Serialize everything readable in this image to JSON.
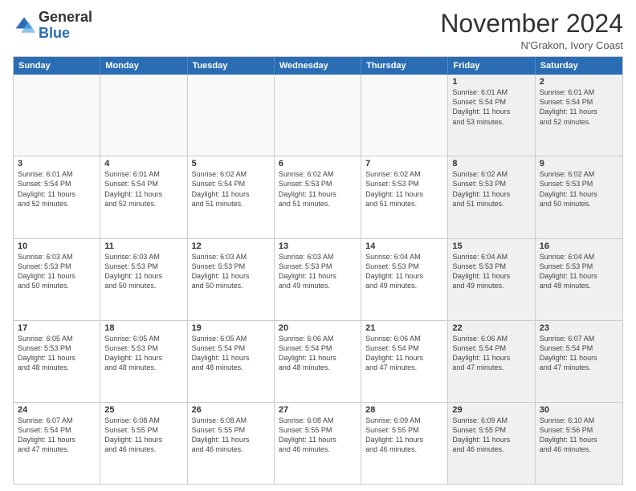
{
  "header": {
    "logo_general": "General",
    "logo_blue": "Blue",
    "month_title": "November 2024",
    "location": "N'Grakon, Ivory Coast"
  },
  "weekdays": [
    "Sunday",
    "Monday",
    "Tuesday",
    "Wednesday",
    "Thursday",
    "Friday",
    "Saturday"
  ],
  "rows": [
    [
      {
        "day": "",
        "info": "",
        "empty": true
      },
      {
        "day": "",
        "info": "",
        "empty": true
      },
      {
        "day": "",
        "info": "",
        "empty": true
      },
      {
        "day": "",
        "info": "",
        "empty": true
      },
      {
        "day": "",
        "info": "",
        "empty": true
      },
      {
        "day": "1",
        "info": "Sunrise: 6:01 AM\nSunset: 5:54 PM\nDaylight: 11 hours\nand 53 minutes.",
        "shaded": true
      },
      {
        "day": "2",
        "info": "Sunrise: 6:01 AM\nSunset: 5:54 PM\nDaylight: 11 hours\nand 52 minutes.",
        "shaded": true
      }
    ],
    [
      {
        "day": "3",
        "info": "Sunrise: 6:01 AM\nSunset: 5:54 PM\nDaylight: 11 hours\nand 52 minutes."
      },
      {
        "day": "4",
        "info": "Sunrise: 6:01 AM\nSunset: 5:54 PM\nDaylight: 11 hours\nand 52 minutes."
      },
      {
        "day": "5",
        "info": "Sunrise: 6:02 AM\nSunset: 5:54 PM\nDaylight: 11 hours\nand 51 minutes."
      },
      {
        "day": "6",
        "info": "Sunrise: 6:02 AM\nSunset: 5:53 PM\nDaylight: 11 hours\nand 51 minutes."
      },
      {
        "day": "7",
        "info": "Sunrise: 6:02 AM\nSunset: 5:53 PM\nDaylight: 11 hours\nand 51 minutes."
      },
      {
        "day": "8",
        "info": "Sunrise: 6:02 AM\nSunset: 5:53 PM\nDaylight: 11 hours\nand 51 minutes.",
        "shaded": true
      },
      {
        "day": "9",
        "info": "Sunrise: 6:02 AM\nSunset: 5:53 PM\nDaylight: 11 hours\nand 50 minutes.",
        "shaded": true
      }
    ],
    [
      {
        "day": "10",
        "info": "Sunrise: 6:03 AM\nSunset: 5:53 PM\nDaylight: 11 hours\nand 50 minutes."
      },
      {
        "day": "11",
        "info": "Sunrise: 6:03 AM\nSunset: 5:53 PM\nDaylight: 11 hours\nand 50 minutes."
      },
      {
        "day": "12",
        "info": "Sunrise: 6:03 AM\nSunset: 5:53 PM\nDaylight: 11 hours\nand 50 minutes."
      },
      {
        "day": "13",
        "info": "Sunrise: 6:03 AM\nSunset: 5:53 PM\nDaylight: 11 hours\nand 49 minutes."
      },
      {
        "day": "14",
        "info": "Sunrise: 6:04 AM\nSunset: 5:53 PM\nDaylight: 11 hours\nand 49 minutes."
      },
      {
        "day": "15",
        "info": "Sunrise: 6:04 AM\nSunset: 5:53 PM\nDaylight: 11 hours\nand 49 minutes.",
        "shaded": true
      },
      {
        "day": "16",
        "info": "Sunrise: 6:04 AM\nSunset: 5:53 PM\nDaylight: 11 hours\nand 48 minutes.",
        "shaded": true
      }
    ],
    [
      {
        "day": "17",
        "info": "Sunrise: 6:05 AM\nSunset: 5:53 PM\nDaylight: 11 hours\nand 48 minutes."
      },
      {
        "day": "18",
        "info": "Sunrise: 6:05 AM\nSunset: 5:53 PM\nDaylight: 11 hours\nand 48 minutes."
      },
      {
        "day": "19",
        "info": "Sunrise: 6:05 AM\nSunset: 5:54 PM\nDaylight: 11 hours\nand 48 minutes."
      },
      {
        "day": "20",
        "info": "Sunrise: 6:06 AM\nSunset: 5:54 PM\nDaylight: 11 hours\nand 48 minutes."
      },
      {
        "day": "21",
        "info": "Sunrise: 6:06 AM\nSunset: 5:54 PM\nDaylight: 11 hours\nand 47 minutes."
      },
      {
        "day": "22",
        "info": "Sunrise: 6:06 AM\nSunset: 5:54 PM\nDaylight: 11 hours\nand 47 minutes.",
        "shaded": true
      },
      {
        "day": "23",
        "info": "Sunrise: 6:07 AM\nSunset: 5:54 PM\nDaylight: 11 hours\nand 47 minutes.",
        "shaded": true
      }
    ],
    [
      {
        "day": "24",
        "info": "Sunrise: 6:07 AM\nSunset: 5:54 PM\nDaylight: 11 hours\nand 47 minutes."
      },
      {
        "day": "25",
        "info": "Sunrise: 6:08 AM\nSunset: 5:55 PM\nDaylight: 11 hours\nand 46 minutes."
      },
      {
        "day": "26",
        "info": "Sunrise: 6:08 AM\nSunset: 5:55 PM\nDaylight: 11 hours\nand 46 minutes."
      },
      {
        "day": "27",
        "info": "Sunrise: 6:08 AM\nSunset: 5:55 PM\nDaylight: 11 hours\nand 46 minutes."
      },
      {
        "day": "28",
        "info": "Sunrise: 6:09 AM\nSunset: 5:55 PM\nDaylight: 11 hours\nand 46 minutes."
      },
      {
        "day": "29",
        "info": "Sunrise: 6:09 AM\nSunset: 5:55 PM\nDaylight: 11 hours\nand 46 minutes.",
        "shaded": true
      },
      {
        "day": "30",
        "info": "Sunrise: 6:10 AM\nSunset: 5:56 PM\nDaylight: 11 hours\nand 46 minutes.",
        "shaded": true
      }
    ]
  ]
}
